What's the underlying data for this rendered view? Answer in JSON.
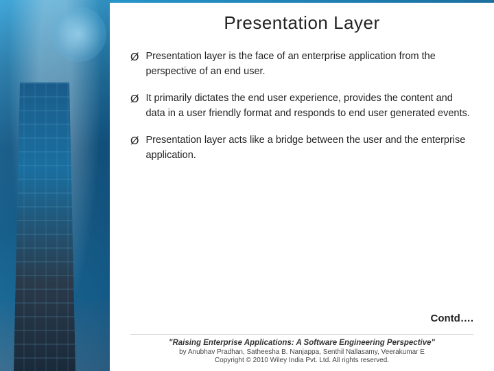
{
  "slide": {
    "title": "Presentation Layer",
    "bullets": [
      {
        "id": "bullet-1",
        "text": "Presentation layer is the face of an enterprise application from the perspective of an end user."
      },
      {
        "id": "bullet-2",
        "text": "It primarily dictates the end user experience, provides the content and data in a user friendly format and responds to end user generated events."
      },
      {
        "id": "bullet-3",
        "text": "Presentation layer acts like a bridge between the user and the enterprise application."
      }
    ],
    "contd": "Contd….",
    "footer": {
      "book_title": "\"Raising Enterprise Applications: A Software Engineering Perspective\"",
      "authors": "by Anubhav Pradhan, Satheesha B. Nanjappa, Senthil Nallasamy, Veerakumar E",
      "copyright": "Copyright © 2010 Wiley India Pvt. Ltd.  All rights reserved."
    }
  },
  "bullet_symbol": "Ø"
}
